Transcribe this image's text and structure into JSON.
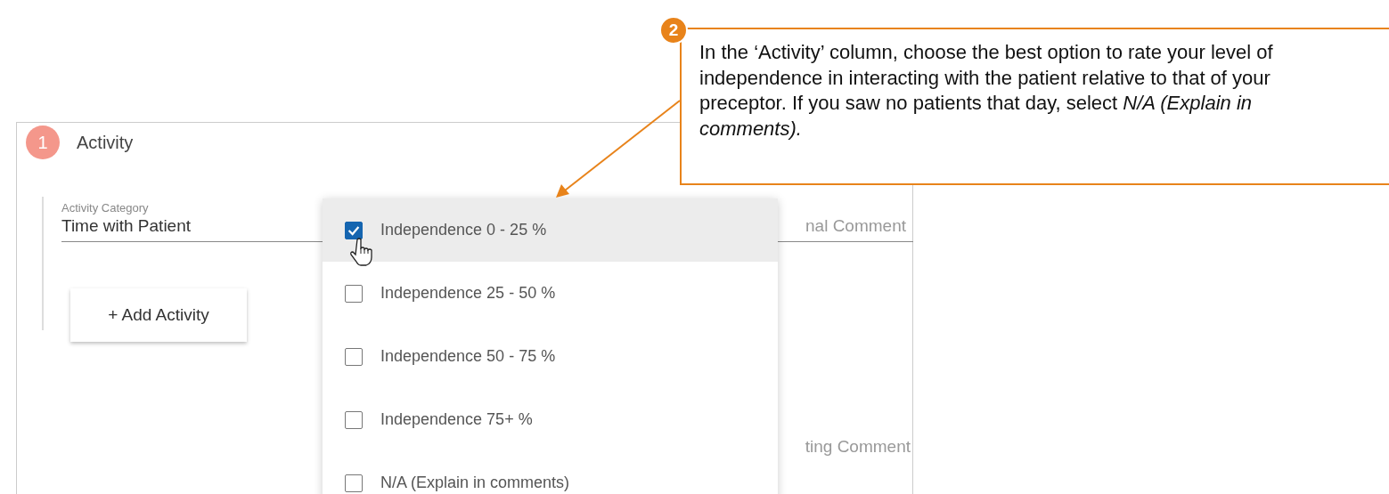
{
  "section": {
    "step": "1",
    "title": "Activity"
  },
  "activity_field": {
    "label": "Activity Category",
    "value": "Time with Patient"
  },
  "comment_fields": [
    {
      "label": "nal Comment"
    },
    {
      "label": "ting Comment"
    }
  ],
  "add_button": "+ Add Activity",
  "options": [
    {
      "label": "Independence 0 - 25 %",
      "checked": true,
      "selected": true
    },
    {
      "label": "Independence 25 - 50 %",
      "checked": false,
      "selected": false
    },
    {
      "label": "Independence 50 - 75 %",
      "checked": false,
      "selected": false
    },
    {
      "label": "Independence 75+ %",
      "checked": false,
      "selected": false
    },
    {
      "label": "N/A (Explain in comments)",
      "checked": false,
      "selected": false
    }
  ],
  "callout": {
    "step": "2",
    "text": "In the ‘Activity’ column, choose the best option to rate your level of independence in interacting with the patient relative to that of your preceptor. If you saw no patients that day, select *N/A (Explain in comments).*"
  }
}
